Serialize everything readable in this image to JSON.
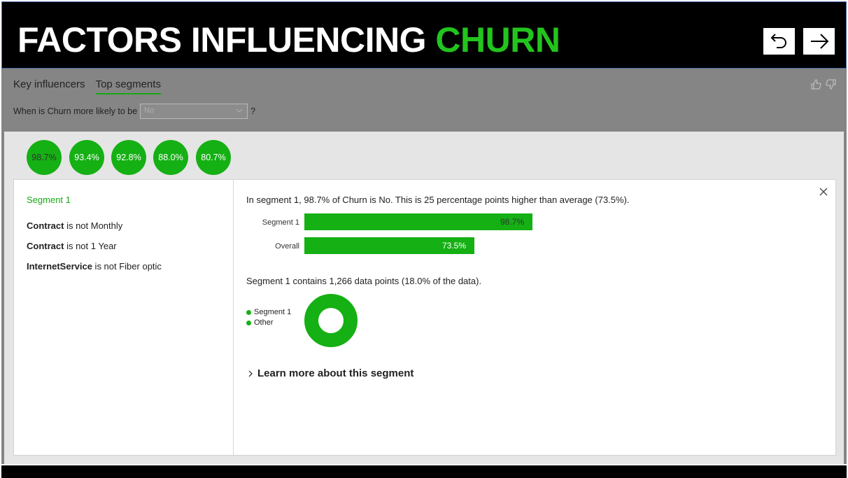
{
  "header": {
    "title_main": "FACTORS INFLUENCING ",
    "title_accent": "CHURN",
    "back_icon": "undo-arrow-icon",
    "forward_icon": "right-arrow-icon"
  },
  "visual": {
    "tabs": [
      {
        "label": "Key influencers",
        "active": false
      },
      {
        "label": "Top segments",
        "active": true
      }
    ],
    "question_prefix": "When is Churn more likely to be",
    "select_value": "No",
    "question_suffix": "?"
  },
  "segments": [
    "98.7%",
    "93.4%",
    "92.8%",
    "88.0%",
    "80.7%"
  ],
  "detail": {
    "segment_name": "Segment 1",
    "conditions": [
      {
        "field": "Contract",
        "rest": " is not Monthly"
      },
      {
        "field": "Contract",
        "rest": " is not 1 Year"
      },
      {
        "field": "InternetService",
        "rest": " is not Fiber optic"
      }
    ],
    "description": "In segment 1, 98.7% of Churn is No. This is 25 percentage points higher than average (73.5%).",
    "bars": [
      {
        "label": "Segment 1",
        "value": 98.7,
        "text": "98.7%"
      },
      {
        "label": "Overall",
        "value": 73.5,
        "text": "73.5%"
      }
    ],
    "count_text": "Segment 1 contains 1,266 data points (18.0% of the data).",
    "legend": [
      "Segment 1",
      "Other"
    ],
    "segment_share": 0.18,
    "learn_more": "Learn more about this segment"
  },
  "colors": {
    "accent": "#22c41d",
    "bar": "#15b014",
    "panel_bg": "#858585"
  }
}
